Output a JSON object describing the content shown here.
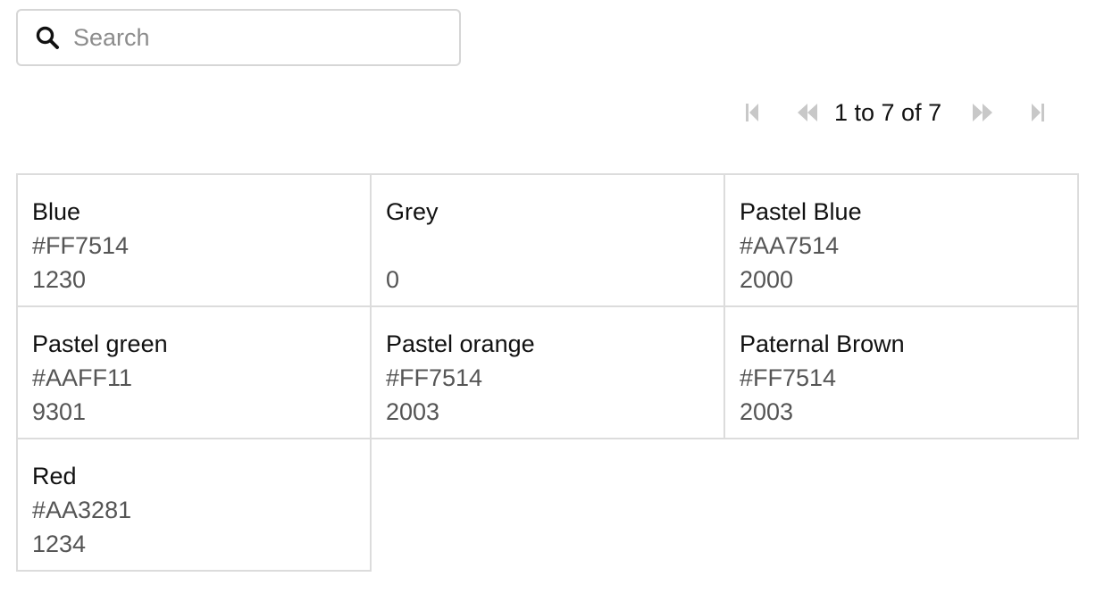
{
  "search": {
    "placeholder": "Search",
    "value": ""
  },
  "pagination": {
    "status": "1 to 7 of 7",
    "first_enabled": false,
    "prev_enabled": false,
    "next_enabled": false,
    "last_enabled": false
  },
  "colors": {
    "border": "#dcdcdc",
    "muted_text": "#555555",
    "disabled_icon": "#c8c8c8"
  },
  "items": [
    {
      "name": "Blue",
      "code": "#FF7514",
      "value": "1230"
    },
    {
      "name": "Grey",
      "code": "",
      "value": "0"
    },
    {
      "name": "Pastel Blue",
      "code": "#AA7514",
      "value": "2000"
    },
    {
      "name": "Pastel green",
      "code": "#AAFF11",
      "value": "9301"
    },
    {
      "name": "Pastel orange",
      "code": "#FF7514",
      "value": "2003"
    },
    {
      "name": "Paternal Brown",
      "code": "#FF7514",
      "value": "2003"
    },
    {
      "name": "Red",
      "code": "#AA3281",
      "value": "1234"
    }
  ]
}
